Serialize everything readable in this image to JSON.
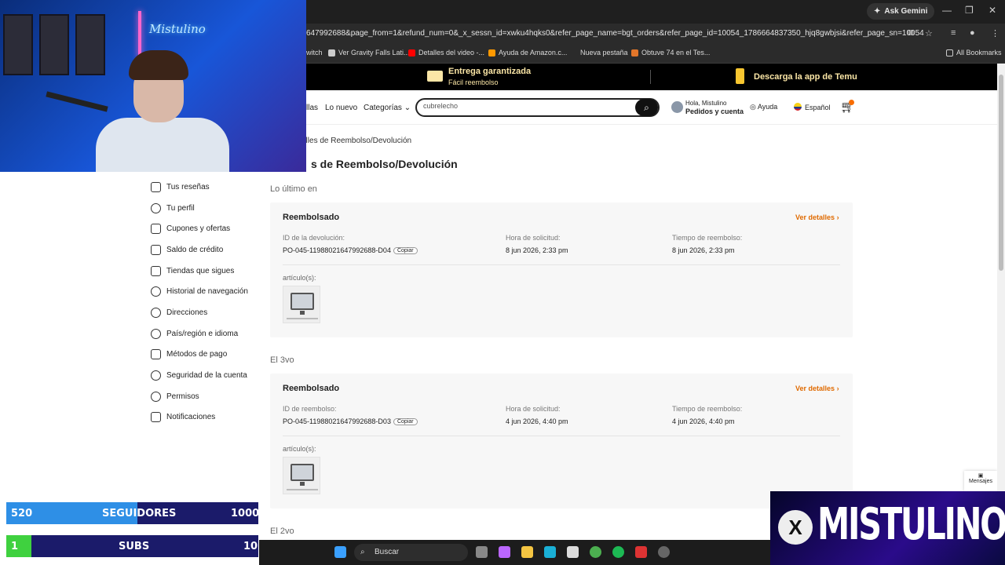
{
  "browser": {
    "ask_gemini": "Ask Gemini",
    "url": "647992688&page_from=1&refund_num=0&_x_sessn_id=xwku4hqks0&refer_page_name=bgt_orders&refer_page_id=10054_1786664837350_hjq8gwbjsi&refer_page_sn=10054",
    "bookmarks": [
      "witch",
      "Ver Gravity Falls Lati...",
      "Detalles del video -...",
      "Ayuda de Amazon.c...",
      "Nueva pestaña",
      "Obtuve 74 en el Tes..."
    ],
    "all_bookmarks": "All Bookmarks"
  },
  "banner": {
    "guarantee_title": "Entrega garantizada",
    "guarantee_sub": "Fácil reembolso",
    "app": "Descarga la app de Temu"
  },
  "header": {
    "nav_partial": "llas",
    "nav_new": "Lo nuevo",
    "nav_categories": "Categorías",
    "search_value": "cubrelecho",
    "greeting": "Hola, Mistulino",
    "orders_account": "Pedidos y cuenta",
    "help": "Ayuda",
    "language": "Español"
  },
  "sidebar": {
    "items": [
      {
        "label": "Tus reseñas",
        "icon": "review-icon"
      },
      {
        "label": "Tu perfil",
        "icon": "user-icon"
      },
      {
        "label": "Cupones y ofertas",
        "icon": "coupon-icon"
      },
      {
        "label": "Saldo de crédito",
        "icon": "credit-icon"
      },
      {
        "label": "Tiendas que sigues",
        "icon": "store-icon"
      },
      {
        "label": "Historial de navegación",
        "icon": "history-icon"
      },
      {
        "label": "Direcciones",
        "icon": "location-icon"
      },
      {
        "label": "País/región e idioma",
        "icon": "globe-icon"
      },
      {
        "label": "Métodos de pago",
        "icon": "card-icon"
      },
      {
        "label": "Seguridad de la cuenta",
        "icon": "shield-icon"
      },
      {
        "label": "Permisos",
        "icon": "permissions-icon"
      },
      {
        "label": "Notificaciones",
        "icon": "bell-icon"
      }
    ]
  },
  "main": {
    "breadcrumb": "alles de Reembolso/Devolución",
    "title": "s de Reembolso/Devolución",
    "sections": [
      {
        "heading": "Lo último en",
        "status": "Reembolsado",
        "details": "Ver detalles",
        "id_label": "ID de la devolución:",
        "id_value": "PO-045-11988021647992688-D04",
        "copy": "Copiar",
        "request_label": "Hora de solicitud:",
        "request_value": "8 jun 2026, 2:33 pm",
        "refund_label": "Tiempo de reembolso:",
        "refund_value": "8 jun 2026, 2:33 pm",
        "items_label": "artículo(s):"
      },
      {
        "heading": "El 3vo",
        "status": "Reembolsado",
        "details": "Ver detalles",
        "id_label": "ID de reembolso:",
        "id_value": "PO-045-11988021647992688-D03",
        "copy": "Copiar",
        "request_label": "Hora de solicitud:",
        "request_value": "4 jun 2026, 4:40 pm",
        "refund_label": "Tiempo de reembolso:",
        "refund_value": "4 jun 2026, 4:40 pm",
        "items_label": "artículo(s):"
      }
    ],
    "next_heading": "El 2vo"
  },
  "messages_label": "Mensajes",
  "stream": {
    "followers_current": "520",
    "followers_label": "SEGUIDORES",
    "followers_goal": "1000",
    "followers_progress": 0.52,
    "subs_current": "1",
    "subs_label": "SUBS",
    "subs_goal": "10",
    "subs_progress": 0.1,
    "channel_name": "MISTULINO",
    "neon_sign": "Mistulino"
  },
  "taskbar": {
    "search": "Buscar"
  },
  "colors": {
    "accent": "#e06a00",
    "banner_text": "#fbe6a6",
    "followers_fill": "#2e8fe6",
    "subs_fill": "#3fd13f"
  }
}
